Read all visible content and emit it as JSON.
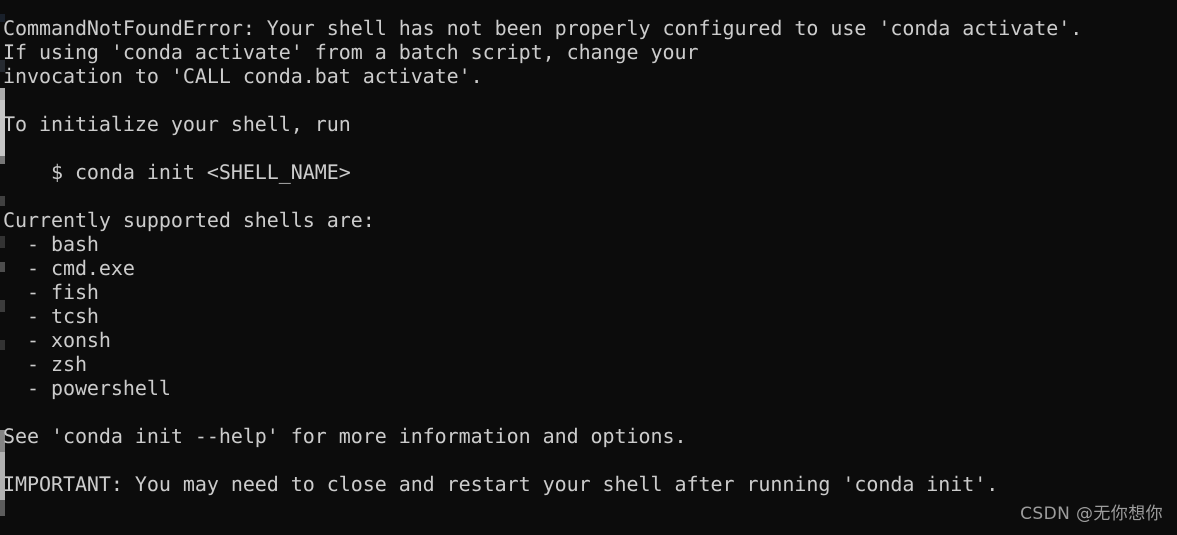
{
  "window": {
    "type": "terminal-console",
    "background_color": "#0c0c0c",
    "foreground_color": "#cccccc"
  },
  "console": {
    "lines": [
      "CommandNotFoundError: Your shell has not been properly configured to use 'conda activate'.",
      "If using 'conda activate' from a batch script, change your",
      "invocation to 'CALL conda.bat activate'.",
      "",
      "To initialize your shell, run",
      "",
      "    $ conda init <SHELL_NAME>",
      "",
      "Currently supported shells are:",
      "  - bash",
      "  - cmd.exe",
      "  - fish",
      "  - tcsh",
      "  - xonsh",
      "  - zsh",
      "  - powershell",
      "",
      "See 'conda init --help' for more information and options.",
      "",
      "IMPORTANT: You may need to close and restart your shell after running 'conda init'."
    ],
    "error_name": "CommandNotFoundError",
    "supported_shells": [
      "bash",
      "cmd.exe",
      "fish",
      "tcsh",
      "xonsh",
      "zsh",
      "powershell"
    ],
    "suggested_command": "$ conda init <SHELL_NAME>",
    "help_command": "conda init --help"
  },
  "watermark": {
    "text": "CSDN @无你想你",
    "color": "#9d9d9d"
  }
}
